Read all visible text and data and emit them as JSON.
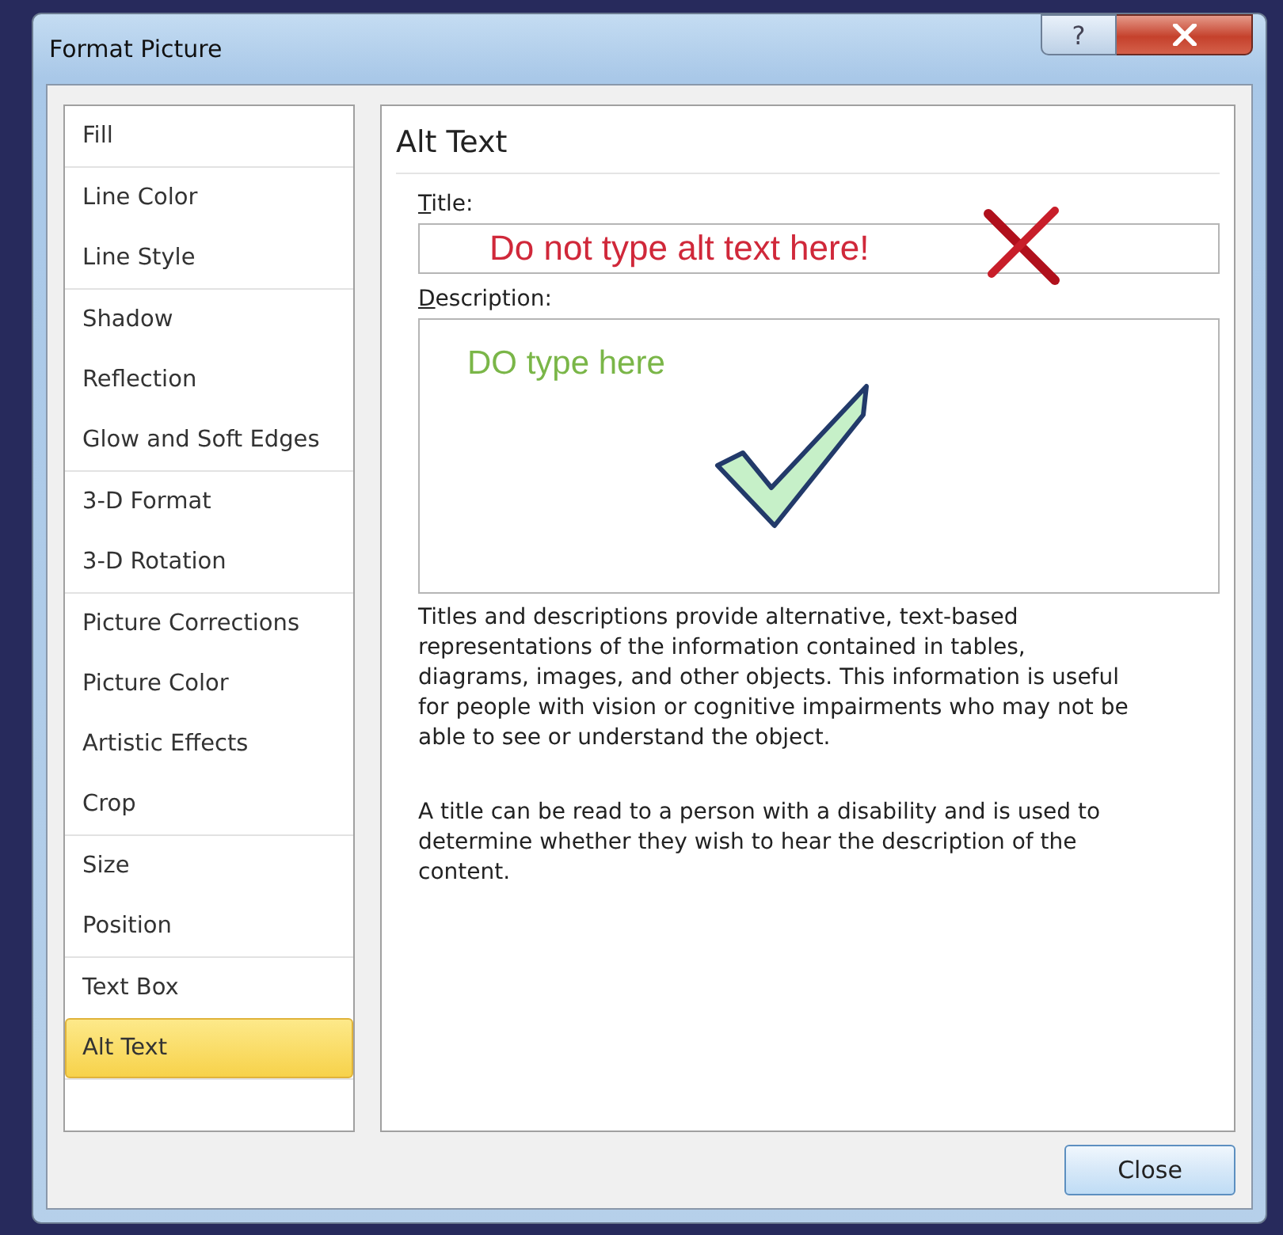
{
  "window": {
    "title": "Format Picture",
    "help_button": "?"
  },
  "sidebar": {
    "groups": [
      {
        "items": [
          {
            "label": "Fill",
            "selected": false
          }
        ]
      },
      {
        "items": [
          {
            "label": "Line Color",
            "selected": false
          },
          {
            "label": "Line Style",
            "selected": false
          }
        ]
      },
      {
        "items": [
          {
            "label": "Shadow",
            "selected": false
          },
          {
            "label": "Reflection",
            "selected": false
          },
          {
            "label": "Glow and Soft Edges",
            "selected": false
          }
        ]
      },
      {
        "items": [
          {
            "label": "3-D Format",
            "selected": false
          },
          {
            "label": "3-D Rotation",
            "selected": false
          }
        ]
      },
      {
        "items": [
          {
            "label": "Picture Corrections",
            "selected": false
          },
          {
            "label": "Picture Color",
            "selected": false
          },
          {
            "label": "Artistic Effects",
            "selected": false
          },
          {
            "label": "Crop",
            "selected": false
          }
        ]
      },
      {
        "items": [
          {
            "label": "Size",
            "selected": false
          },
          {
            "label": "Position",
            "selected": false
          }
        ]
      },
      {
        "items": [
          {
            "label": "Text Box",
            "selected": false
          },
          {
            "label": "Alt Text",
            "selected": true
          }
        ]
      }
    ]
  },
  "panel": {
    "heading": "Alt Text",
    "title_label": "Title:",
    "title_field": {
      "value": "Do not type alt text here!"
    },
    "description_label": "Description:",
    "description_field": {
      "value": "DO type here"
    },
    "paragraphs": [
      "Titles and descriptions provide alternative, text-based representations of the information contained in tables, diagrams, images, and other objects. This information is useful for people with vision or cognitive impairments who may not be able to see or understand the object.",
      "A title can be read to a person with a disability and is used to determine whether they wish to hear the description of the content."
    ]
  },
  "buttons": [
    "Close"
  ]
}
